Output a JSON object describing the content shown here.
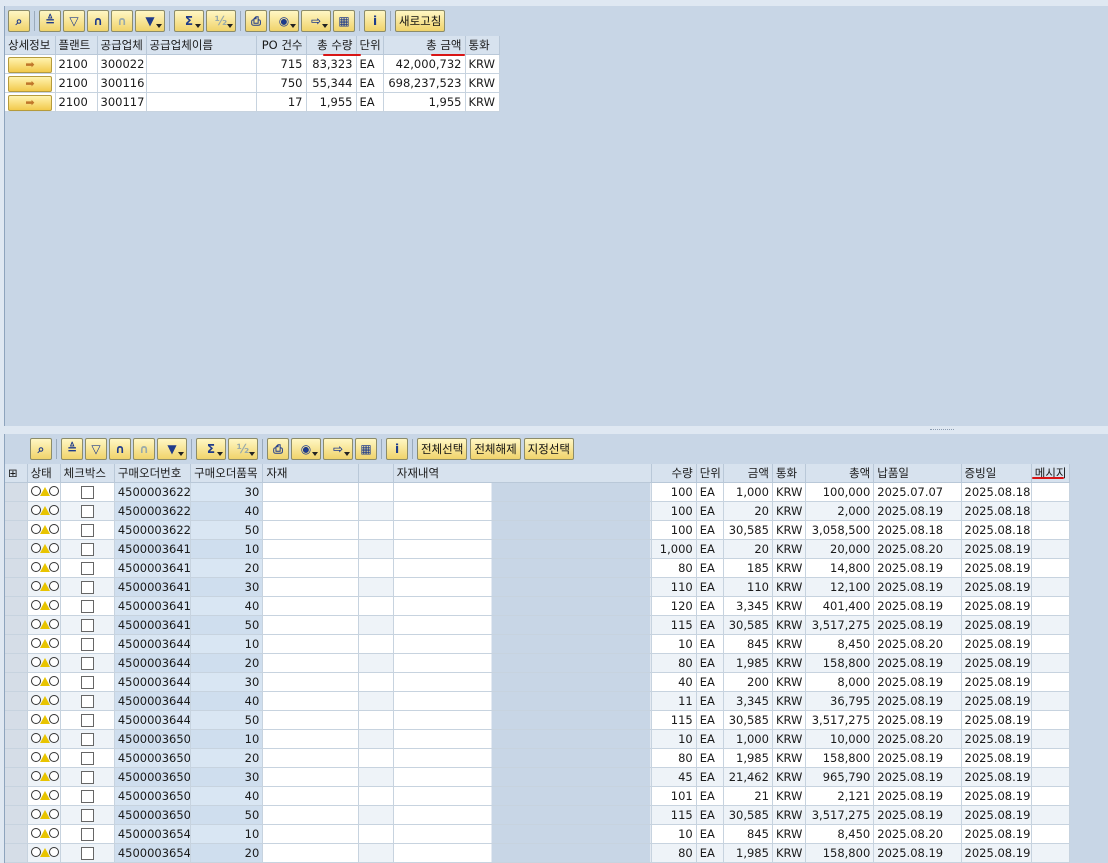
{
  "top": {
    "toolbar": {
      "icons": [
        "zoom-icon",
        "sort-ascending-icon",
        "sort-descending-icon",
        "find-icon",
        "find-next-icon",
        "filter-icon",
        "sum-icon",
        "subtotal-icon",
        "print-icon",
        "views-icon",
        "export-icon",
        "layout-icon",
        "info-icon"
      ],
      "refresh_label": "새로고침"
    },
    "columns": [
      "상세정보",
      "플랜트",
      "공급업체",
      "공급업체이름",
      "PO 건수",
      "총 수량",
      "단위",
      "총 금액",
      "통화"
    ],
    "detail_icon": "➡",
    "rows": [
      {
        "plant": "2100",
        "vendor": "300022",
        "vendor_name": "",
        "po_count": "715",
        "total_qty": "83,323",
        "unit": "EA",
        "total_amount": "42,000,732",
        "currency": "KRW"
      },
      {
        "plant": "2100",
        "vendor": "300116",
        "vendor_name": "",
        "po_count": "750",
        "total_qty": "55,344",
        "unit": "EA",
        "total_amount": "698,237,523",
        "currency": "KRW"
      },
      {
        "plant": "2100",
        "vendor": "300117",
        "vendor_name": "",
        "po_count": "17",
        "total_qty": "1,955",
        "unit": "EA",
        "total_amount": "1,955",
        "currency": "KRW"
      }
    ]
  },
  "bottom": {
    "toolbar": {
      "icons": [
        "zoom-icon",
        "sort-ascending-icon",
        "sort-descending-icon",
        "find-icon",
        "find-next-icon",
        "filter-icon",
        "sum-icon",
        "subtotal-icon",
        "print-icon",
        "views-icon",
        "export-icon",
        "layout-icon",
        "info-icon"
      ],
      "select_all_label": "전체선택",
      "deselect_all_label": "전체해제",
      "select_label": "지정선택"
    },
    "columns": [
      "상태",
      "체크박스",
      "구매오더번호",
      "구매오더품목",
      "자재",
      "자재내역",
      "수량",
      "단위",
      "금액",
      "통화",
      "총액",
      "납품일",
      "증빙일",
      "메시지"
    ],
    "rows": [
      {
        "po": "4500003622",
        "item": "30",
        "qty": "100",
        "unit": "EA",
        "price": "1,000",
        "currency": "KRW",
        "total": "100,000",
        "delivery": "2025.07.07",
        "doc_date": "2025.08.18"
      },
      {
        "po": "4500003622",
        "item": "40",
        "qty": "100",
        "unit": "EA",
        "price": "20",
        "currency": "KRW",
        "total": "2,000",
        "delivery": "2025.08.19",
        "doc_date": "2025.08.18"
      },
      {
        "po": "4500003622",
        "item": "50",
        "qty": "100",
        "unit": "EA",
        "price": "30,585",
        "currency": "KRW",
        "total": "3,058,500",
        "delivery": "2025.08.18",
        "doc_date": "2025.08.18"
      },
      {
        "po": "4500003641",
        "item": "10",
        "qty": "1,000",
        "unit": "EA",
        "price": "20",
        "currency": "KRW",
        "total": "20,000",
        "delivery": "2025.08.20",
        "doc_date": "2025.08.19"
      },
      {
        "po": "4500003641",
        "item": "20",
        "qty": "80",
        "unit": "EA",
        "price": "185",
        "currency": "KRW",
        "total": "14,800",
        "delivery": "2025.08.19",
        "doc_date": "2025.08.19"
      },
      {
        "po": "4500003641",
        "item": "30",
        "qty": "110",
        "unit": "EA",
        "price": "110",
        "currency": "KRW",
        "total": "12,100",
        "delivery": "2025.08.19",
        "doc_date": "2025.08.19"
      },
      {
        "po": "4500003641",
        "item": "40",
        "qty": "120",
        "unit": "EA",
        "price": "3,345",
        "currency": "KRW",
        "total": "401,400",
        "delivery": "2025.08.19",
        "doc_date": "2025.08.19"
      },
      {
        "po": "4500003641",
        "item": "50",
        "qty": "115",
        "unit": "EA",
        "price": "30,585",
        "currency": "KRW",
        "total": "3,517,275",
        "delivery": "2025.08.19",
        "doc_date": "2025.08.19"
      },
      {
        "po": "4500003644",
        "item": "10",
        "qty": "10",
        "unit": "EA",
        "price": "845",
        "currency": "KRW",
        "total": "8,450",
        "delivery": "2025.08.20",
        "doc_date": "2025.08.19"
      },
      {
        "po": "4500003644",
        "item": "20",
        "qty": "80",
        "unit": "EA",
        "price": "1,985",
        "currency": "KRW",
        "total": "158,800",
        "delivery": "2025.08.19",
        "doc_date": "2025.08.19"
      },
      {
        "po": "4500003644",
        "item": "30",
        "qty": "40",
        "unit": "EA",
        "price": "200",
        "currency": "KRW",
        "total": "8,000",
        "delivery": "2025.08.19",
        "doc_date": "2025.08.19"
      },
      {
        "po": "4500003644",
        "item": "40",
        "qty": "11",
        "unit": "EA",
        "price": "3,345",
        "currency": "KRW",
        "total": "36,795",
        "delivery": "2025.08.19",
        "doc_date": "2025.08.19"
      },
      {
        "po": "4500003644",
        "item": "50",
        "qty": "115",
        "unit": "EA",
        "price": "30,585",
        "currency": "KRW",
        "total": "3,517,275",
        "delivery": "2025.08.19",
        "doc_date": "2025.08.19"
      },
      {
        "po": "4500003650",
        "item": "10",
        "qty": "10",
        "unit": "EA",
        "price": "1,000",
        "currency": "KRW",
        "total": "10,000",
        "delivery": "2025.08.20",
        "doc_date": "2025.08.19"
      },
      {
        "po": "4500003650",
        "item": "20",
        "qty": "80",
        "unit": "EA",
        "price": "1,985",
        "currency": "KRW",
        "total": "158,800",
        "delivery": "2025.08.19",
        "doc_date": "2025.08.19"
      },
      {
        "po": "4500003650",
        "item": "30",
        "qty": "45",
        "unit": "EA",
        "price": "21,462",
        "currency": "KRW",
        "total": "965,790",
        "delivery": "2025.08.19",
        "doc_date": "2025.08.19"
      },
      {
        "po": "4500003650",
        "item": "40",
        "qty": "101",
        "unit": "EA",
        "price": "21",
        "currency": "KRW",
        "total": "2,121",
        "delivery": "2025.08.19",
        "doc_date": "2025.08.19"
      },
      {
        "po": "4500003650",
        "item": "50",
        "qty": "115",
        "unit": "EA",
        "price": "30,585",
        "currency": "KRW",
        "total": "3,517,275",
        "delivery": "2025.08.19",
        "doc_date": "2025.08.19"
      },
      {
        "po": "4500003654",
        "item": "10",
        "qty": "10",
        "unit": "EA",
        "price": "845",
        "currency": "KRW",
        "total": "8,450",
        "delivery": "2025.08.20",
        "doc_date": "2025.08.19"
      },
      {
        "po": "4500003654",
        "item": "20",
        "qty": "80",
        "unit": "EA",
        "price": "1,985",
        "currency": "KRW",
        "total": "158,800",
        "delivery": "2025.08.19",
        "doc_date": "2025.08.19"
      }
    ]
  },
  "colors": {
    "highlight": "#d81515",
    "button_face": "#f0d36b",
    "pane_bg": "#c8d6e6"
  }
}
